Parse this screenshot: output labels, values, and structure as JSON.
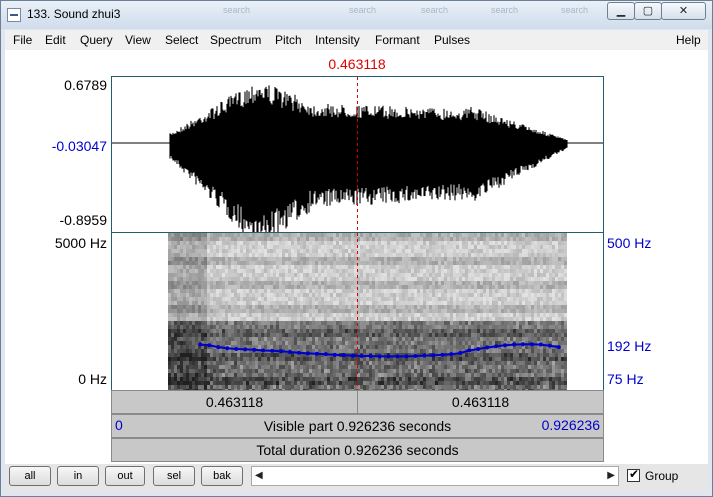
{
  "window": {
    "title": "133. Sound zhui3"
  },
  "background_windows": [
    "search",
    "search",
    "search",
    "search",
    "search"
  ],
  "menu": [
    "File",
    "Edit",
    "Query",
    "View",
    "Select",
    "Spectrum",
    "Pitch",
    "Intensity",
    "Formant",
    "Pulses",
    "Help"
  ],
  "cursor": {
    "time_label": "0.463118",
    "time_fraction": 0.5
  },
  "waveform": {
    "max_label": "0.6789",
    "zero_label": "-0.03047",
    "min_label": "-0.8959"
  },
  "spectrogram": {
    "top_freq_label": "5000 Hz",
    "bottom_freq_label": "0 Hz"
  },
  "pitch": {
    "top_label": "500 Hz",
    "mid_label": "192 Hz",
    "bottom_label": "75 Hz",
    "track_hz": [
      198,
      196,
      191,
      188,
      186,
      185,
      184,
      182,
      181,
      180,
      178,
      176,
      174,
      173,
      172,
      170,
      169,
      168,
      167,
      167,
      166,
      166,
      166,
      166,
      167,
      168,
      169,
      170,
      172,
      175,
      182,
      186,
      190,
      193,
      196,
      198,
      199,
      199,
      198,
      195,
      191
    ],
    "track_start_fraction": 0.18,
    "track_end_fraction": 0.91,
    "range_hz": [
      75,
      500
    ]
  },
  "time_bars": {
    "left_segment": "0.463118",
    "right_segment": "0.463118",
    "visible_start": "0",
    "visible_label": "Visible part 0.926236 seconds",
    "visible_end": "0.926236",
    "total_label": "Total duration 0.926236 seconds"
  },
  "buttons": {
    "all": "all",
    "in": "in",
    "out": "out",
    "sel": "sel",
    "bak": "bak"
  },
  "scrollbar": {
    "left_arrow": "◀",
    "right_arrow": "▶"
  },
  "group": {
    "label": "Group",
    "checked": true
  },
  "colors": {
    "cursor": "#dd0000",
    "pitch": "#0000cc",
    "frame": "#1f5f6f"
  }
}
